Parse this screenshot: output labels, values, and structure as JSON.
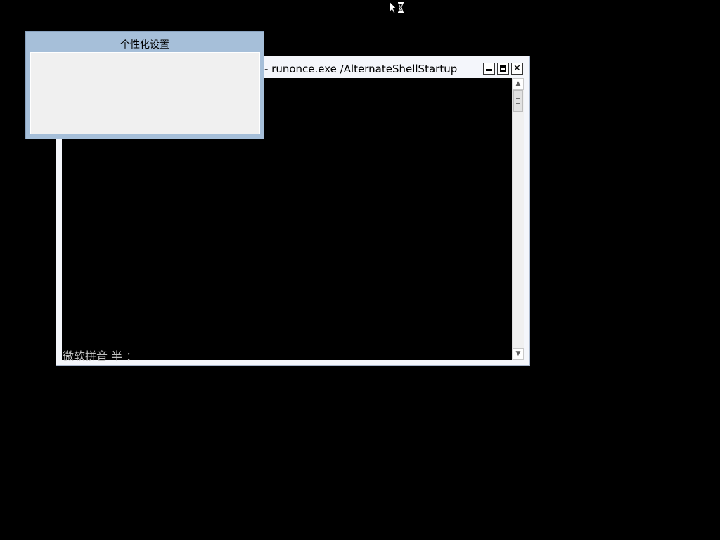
{
  "console_window": {
    "title": "- runonce.exe  /AlternateShellStartup",
    "controls": {
      "minimize_icon": "minimize-icon",
      "maximize_icon": "maximize-icon",
      "close_icon": "close-icon"
    },
    "ime_status_text": "微软拼音 半 ：",
    "scrollbar": {
      "up_arrow": "chevron-up-icon",
      "down_arrow": "chevron-down-icon"
    }
  },
  "personalize_window": {
    "title": "个性化设置"
  },
  "cursor": {
    "icon": "busy-pointer-icon"
  },
  "colors": {
    "desktop": "#000000",
    "console_frame": "#f4f6fb",
    "dialog_frame": "#a6bfd9",
    "dialog_body": "#f0f0f0",
    "ime_text": "#c0c0c0"
  }
}
